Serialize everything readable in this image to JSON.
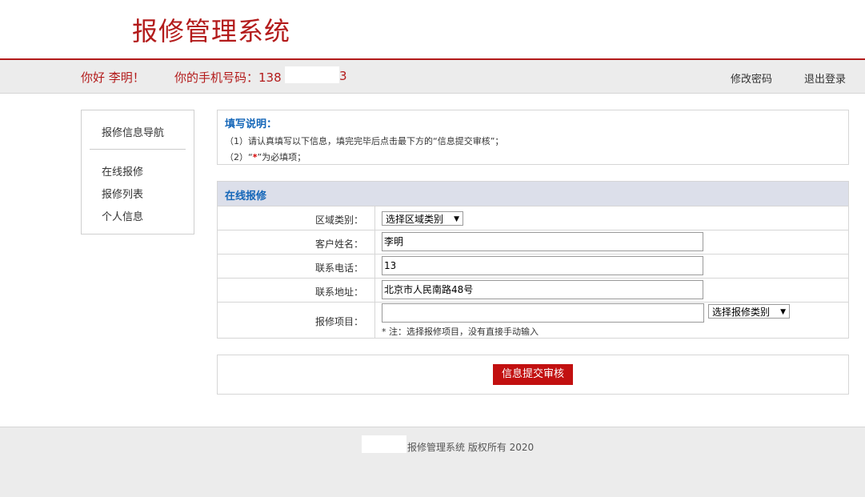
{
  "header": {
    "title": "报修管理系统"
  },
  "userbar": {
    "greeting": "你好 李明！",
    "phone_label": "你的手机号码：13",
    "phone_prefix": "8",
    "phone_suffix": "3",
    "change_password": "修改密码",
    "logout": "退出登录"
  },
  "sidebar": {
    "title": "报修信息导航",
    "items": [
      {
        "label": "在线报修"
      },
      {
        "label": "报修列表"
      },
      {
        "label": "个人信息"
      }
    ]
  },
  "instructions": {
    "title": "填写说明：",
    "line1": "（1）请认真填写以下信息，填完完毕后点击最下方的“信息提交审核”；",
    "line2_pre": "（2）“",
    "line2_star": "*",
    "line2_post": "”为必填项；"
  },
  "form": {
    "title": "在线报修",
    "area_label": "区域类别：",
    "area_select": "选择区域类别",
    "name_label": "客户姓名：",
    "name_value": "李明",
    "phone_label": "联系电话：",
    "phone_value": "13",
    "address_label": "联系地址：",
    "address_value": "北京市人民南路48号",
    "item_label": "报修项目：",
    "item_value": "",
    "item_select": "选择报修类别",
    "item_note": "* 注：选择报修项目，没有直接手动输入"
  },
  "submit": {
    "label": "信息提交审核"
  },
  "footer": {
    "copyright": "报修管理系统  版权所有    2020"
  },
  "colors": {
    "brand_red": "#b31b1b",
    "accent_blue": "#1466b8",
    "button_red": "#c21010"
  }
}
